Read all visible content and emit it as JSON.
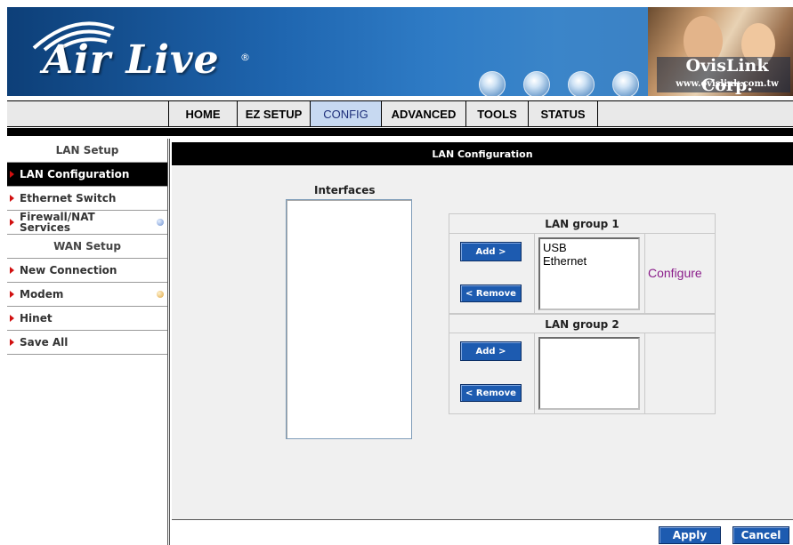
{
  "banner": {
    "logo_text": "Air Live",
    "logo_registered": "®",
    "brand_name": "OvisLink Corp.",
    "brand_url": "www.ovislink.com.tw"
  },
  "nav": {
    "tabs": [
      {
        "label": "HOME",
        "active": false
      },
      {
        "label": "EZ SETUP",
        "active": false
      },
      {
        "label": "CONFIG",
        "active": true
      },
      {
        "label": "ADVANCED",
        "active": false
      },
      {
        "label": "TOOLS",
        "active": false
      },
      {
        "label": "STATUS",
        "active": false
      }
    ]
  },
  "sidebar": {
    "lan_section": "LAN Setup",
    "items": [
      {
        "label": "LAN Configuration",
        "active": true
      },
      {
        "label": "Ethernet Switch"
      },
      {
        "label": "Firewall/NAT Services",
        "line1": "Firewall/NAT",
        "line2": "Services"
      }
    ],
    "wan_section": "WAN Setup",
    "wan_items": [
      {
        "label": "New Connection"
      },
      {
        "label": "Modem"
      },
      {
        "label": "Hinet"
      },
      {
        "label": "Save All"
      }
    ]
  },
  "main": {
    "header": "LAN Configuration",
    "interfaces_label": "Interfaces",
    "interfaces_items": [],
    "groups": [
      {
        "title": "LAN group 1",
        "add_label": "Add >",
        "remove_label": "< Remove",
        "items": [
          "USB",
          "Ethernet"
        ],
        "configure_label": "Configure"
      },
      {
        "title": "LAN group 2",
        "add_label": "Add >",
        "remove_label": "< Remove",
        "items": [],
        "configure_label": ""
      }
    ]
  },
  "footer": {
    "apply_label": "Apply",
    "cancel_label": "Cancel"
  },
  "colors": {
    "button_blue": "#1d5bb0",
    "active_tab": "#c7d9f1",
    "configure_link": "#8a1d8a",
    "sidebar_arrow": "#d11010"
  }
}
